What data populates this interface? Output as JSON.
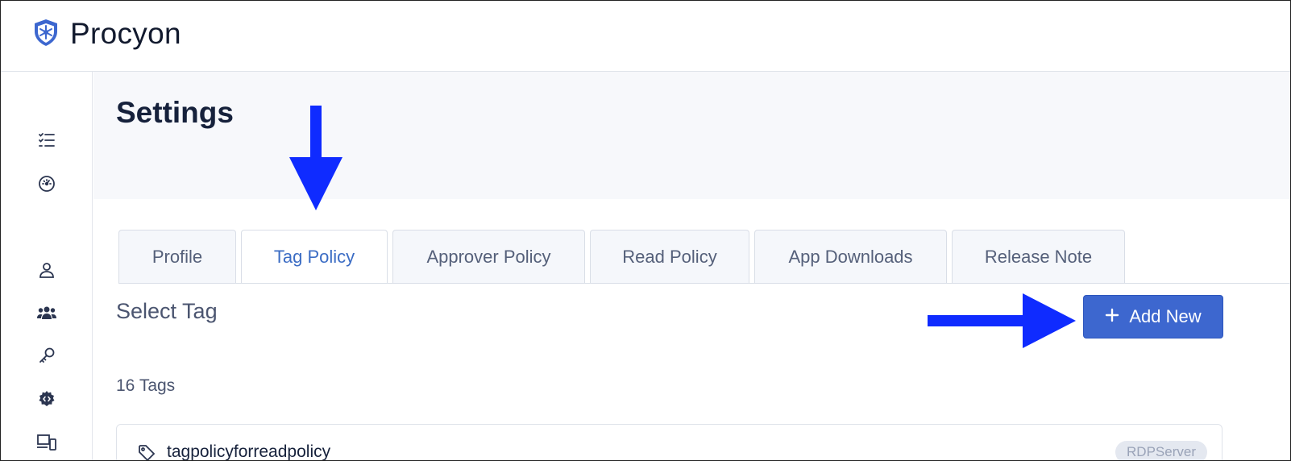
{
  "app": {
    "name": "Procyon"
  },
  "sidebar": {
    "items": [
      {
        "icon": "checklist-icon"
      },
      {
        "icon": "dashboard-gauge-icon"
      },
      {
        "icon": "user-icon"
      },
      {
        "icon": "users-group-icon"
      },
      {
        "icon": "key-icon"
      },
      {
        "icon": "settings-code-icon"
      },
      {
        "icon": "devices-icon"
      }
    ]
  },
  "main": {
    "title": "Settings",
    "tabs": [
      {
        "label": "Profile",
        "active": false
      },
      {
        "label": "Tag Policy",
        "active": true
      },
      {
        "label": "Approver Policy",
        "active": false
      },
      {
        "label": "Read Policy",
        "active": false
      },
      {
        "label": "App Downloads",
        "active": false
      },
      {
        "label": "Release Note",
        "active": false
      }
    ],
    "section_title": "Select Tag",
    "add_button_label": "Add New",
    "tags_count": "16 Tags",
    "tag_items": [
      {
        "name": "tagpolicyforreadpolicy",
        "badge": "RDPServer"
      }
    ]
  },
  "colors": {
    "accent": "#3d67cf",
    "active_tab_text": "#3b6cc4",
    "annotation_arrow": "#0f2bff"
  }
}
